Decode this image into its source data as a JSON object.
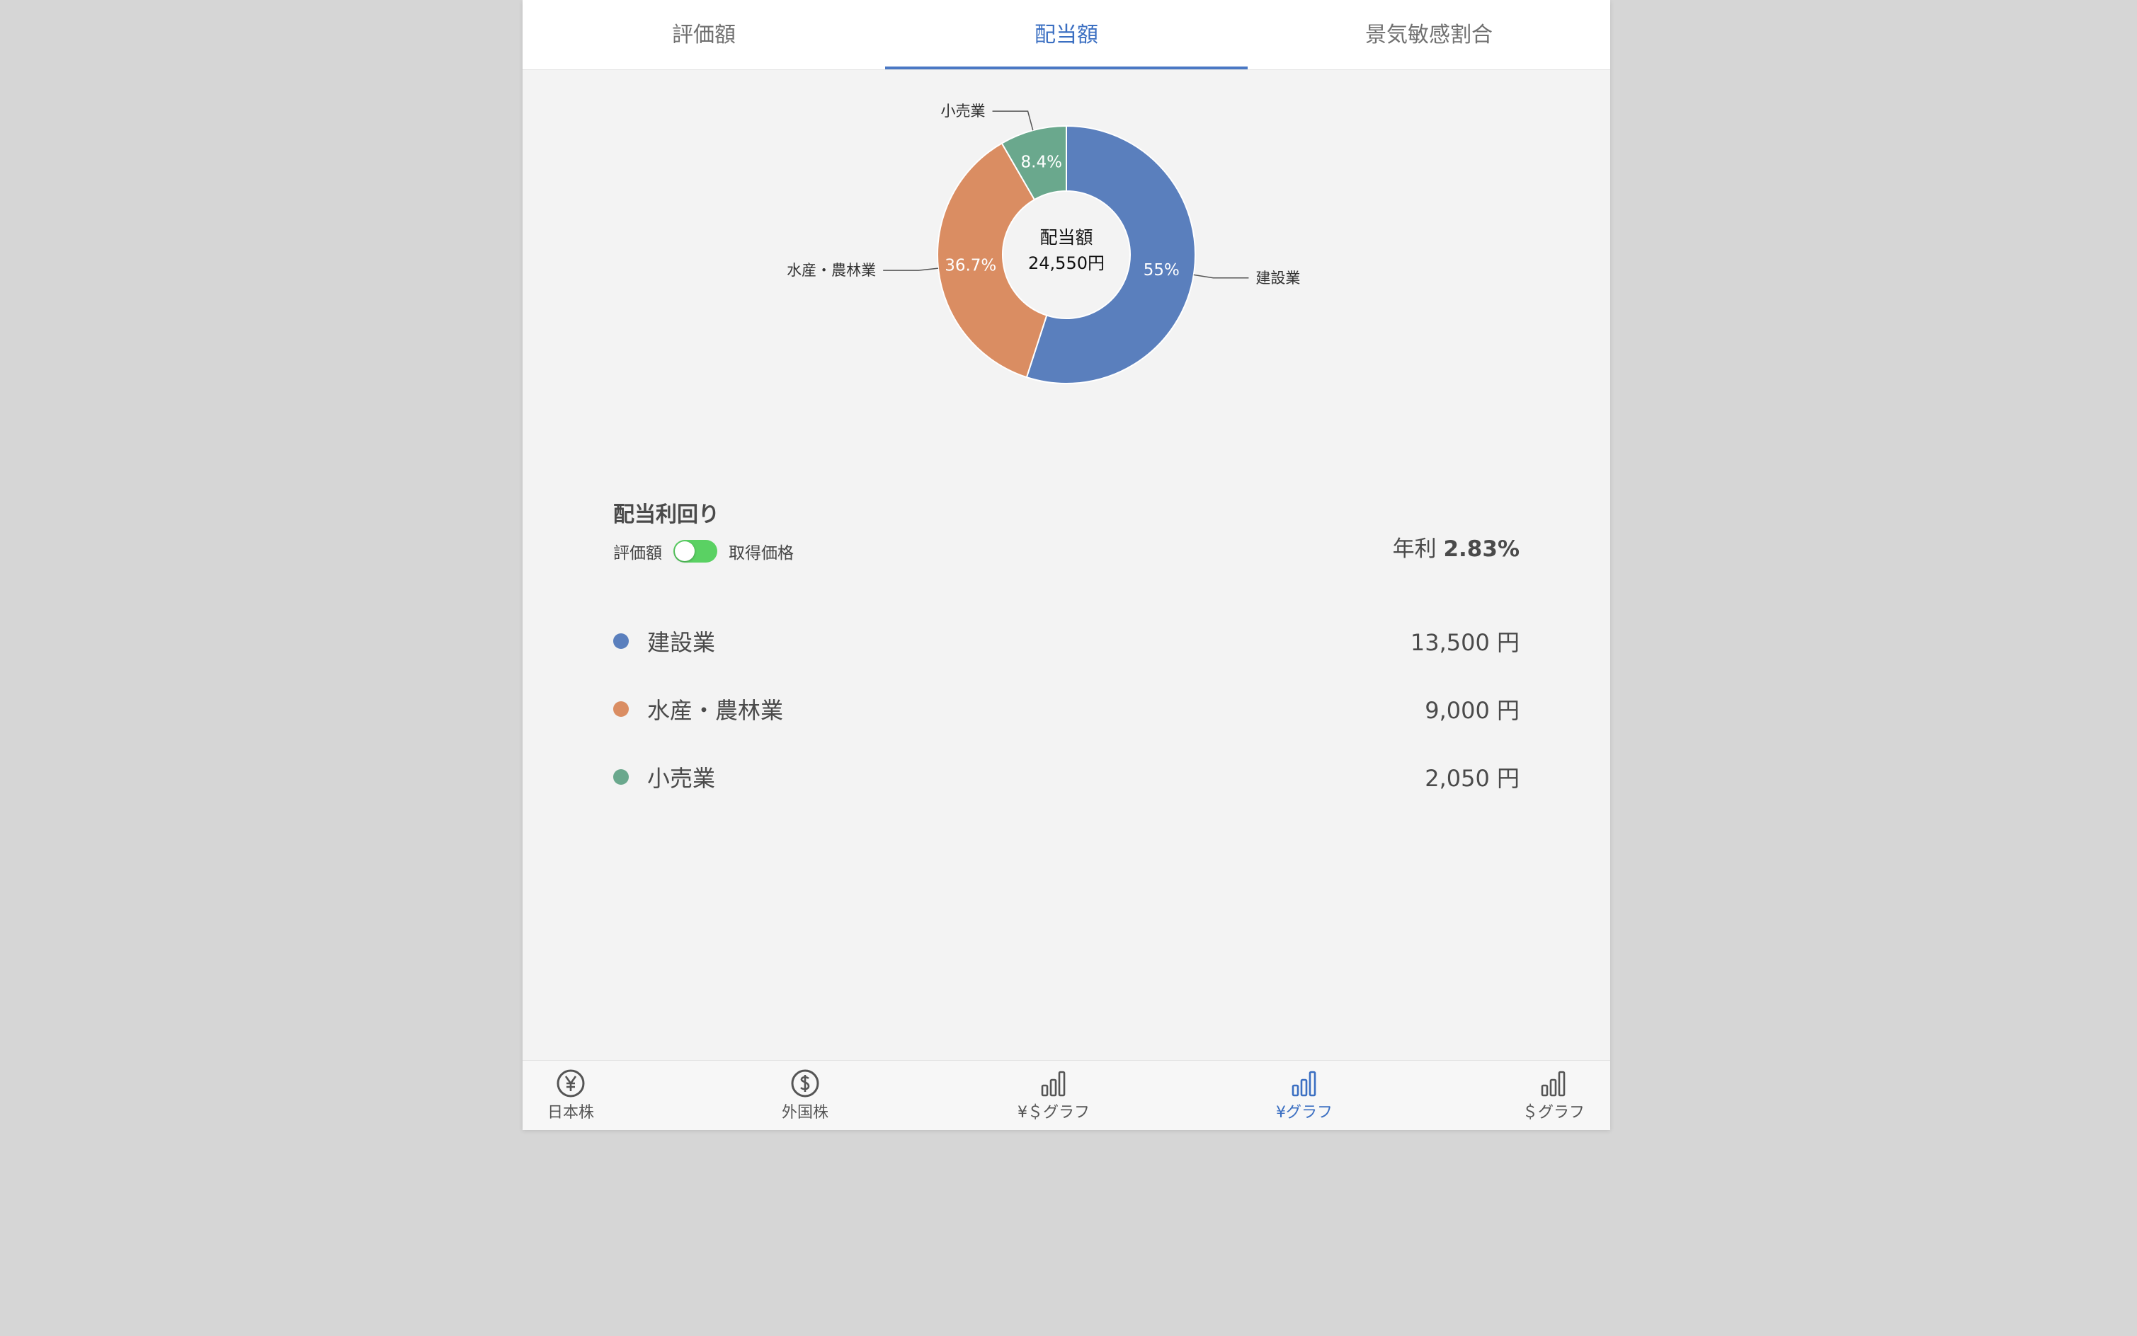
{
  "tabs": [
    {
      "label": "評価額",
      "active": false
    },
    {
      "label": "配当額",
      "active": true
    },
    {
      "label": "景気敏感割合",
      "active": false
    }
  ],
  "chart_data": {
    "type": "pie",
    "center_title": "配当額",
    "center_value": "24,550円",
    "categories": [
      "建設業",
      "水産・農林業",
      "小売業"
    ],
    "values": [
      13500,
      9000,
      2050
    ],
    "percent_labels": [
      "55%",
      "36.7%",
      "8.4%"
    ],
    "colors": [
      "#5a7fbd",
      "#da8d62",
      "#6aa88d"
    ]
  },
  "yield": {
    "title": "配当利回り",
    "toggle_left": "評価額",
    "toggle_right": "取得価格",
    "toggle_on": true,
    "annual_prefix": "年利",
    "annual_value": "2.83%"
  },
  "legend": [
    {
      "name": "建設業",
      "amount": "13,500 円",
      "color": "#5a7fbd"
    },
    {
      "name": "水産・農林業",
      "amount": "9,000 円",
      "color": "#da8d62"
    },
    {
      "name": "小売業",
      "amount": "2,050 円",
      "color": "#6aa88d"
    }
  ],
  "bottom_nav": [
    {
      "label": "日本株",
      "icon": "yen-circle-icon",
      "active": false
    },
    {
      "label": "外国株",
      "icon": "dollar-circle-icon",
      "active": false
    },
    {
      "label": "¥＄グラフ",
      "icon": "bar-chart-icon",
      "active": false
    },
    {
      "label": "¥グラフ",
      "icon": "bar-chart-icon",
      "active": true
    },
    {
      "label": "＄グラフ",
      "icon": "bar-chart-icon",
      "active": false
    }
  ]
}
